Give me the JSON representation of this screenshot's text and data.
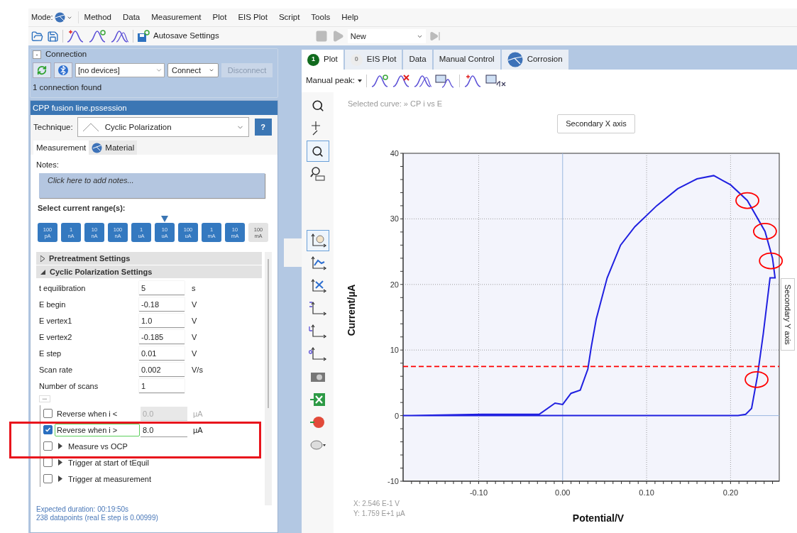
{
  "menu": {
    "mode_label": "Mode:",
    "items": [
      "Method",
      "Data",
      "Measurement",
      "Plot",
      "EIS Plot",
      "Script",
      "Tools",
      "Help"
    ]
  },
  "toolbar": {
    "autosave": "Autosave Settings",
    "run_selector": "New"
  },
  "connection": {
    "title": "Connection",
    "collapse": "-",
    "device": "[no devices]",
    "connect": "Connect",
    "disconnect": "Disconnect",
    "disconnect_disabled": true,
    "status": "1 connection found"
  },
  "session": {
    "title": "CPP fusion line.pssession",
    "technique_label": "Technique:",
    "technique": "Cyclic Polarization",
    "help": "?",
    "tabs": [
      {
        "label": "Measurement",
        "selected": true
      },
      {
        "label": "Material",
        "selected": false
      }
    ],
    "notes_label": "Notes:",
    "notes_placeholder": "Click here to add notes...",
    "ranges_label": "Select current range(s):",
    "ranges": [
      {
        "value": "100",
        "unit": "pA",
        "selected": true,
        "marked": false
      },
      {
        "value": "1",
        "unit": "nA",
        "selected": true,
        "marked": false
      },
      {
        "value": "10",
        "unit": "nA",
        "selected": true,
        "marked": false
      },
      {
        "value": "100",
        "unit": "nA",
        "selected": true,
        "marked": false
      },
      {
        "value": "1",
        "unit": "uA",
        "selected": true,
        "marked": false
      },
      {
        "value": "10",
        "unit": "uA",
        "selected": true,
        "marked": true
      },
      {
        "value": "100",
        "unit": "uA",
        "selected": true,
        "marked": false
      },
      {
        "value": "1",
        "unit": "mA",
        "selected": true,
        "marked": false
      },
      {
        "value": "10",
        "unit": "mA",
        "selected": true,
        "marked": false
      },
      {
        "value": "100",
        "unit": "mA",
        "selected": false,
        "marked": false
      }
    ],
    "sections": [
      {
        "label": "Pretreatment Settings",
        "expanded": false
      },
      {
        "label": "Cyclic Polarization Settings",
        "expanded": true
      }
    ],
    "params": [
      {
        "label": "t equilibration",
        "value": "5",
        "unit": "s"
      },
      {
        "label": "E begin",
        "value": "-0.18",
        "unit": "V"
      },
      {
        "label": "E vertex1",
        "value": "1.0",
        "unit": "V"
      },
      {
        "label": "E vertex2",
        "value": "-0.185",
        "unit": "V"
      },
      {
        "label": "E step",
        "value": "0.01",
        "unit": "V"
      },
      {
        "label": "Scan rate",
        "value": "0.002",
        "unit": "V/s"
      },
      {
        "label": "Number of scans",
        "value": "1"
      }
    ],
    "more": "•••",
    "options": [
      {
        "kind": "limit",
        "label": "Reverse when i <",
        "checked": false,
        "value": "0.0",
        "unit": "µA",
        "disabled": true,
        "focused": false,
        "highlighted": false
      },
      {
        "kind": "limit",
        "label": "Reverse when i >",
        "checked": true,
        "value": "8.0",
        "unit": "µA",
        "disabled": false,
        "focused": true,
        "highlighted": true
      },
      {
        "kind": "expander",
        "label": "Measure vs OCP",
        "checked": false,
        "highlighted": true
      },
      {
        "kind": "expander",
        "label": "Trigger at start of tEquil",
        "checked": false,
        "highlighted": false
      },
      {
        "kind": "expander",
        "label": "Trigger at measurement",
        "checked": false,
        "highlighted": false
      }
    ],
    "duration": "Expected duration: 00:19:50s",
    "datapoints": "238 datapoints (real E step is 0.00999)"
  },
  "plot_tabs": [
    {
      "label": "Plot",
      "badge": "1",
      "badge_on": true,
      "selected": true
    },
    {
      "label": "EIS Plot",
      "badge": "0",
      "badge_on": false,
      "selected": false
    },
    {
      "label": "Data",
      "selected": false
    },
    {
      "label": "Manual Control",
      "selected": false
    },
    {
      "label": "Corrosion",
      "icon": true,
      "selected": false
    }
  ],
  "peak_toolbar": {
    "label": "Manual peak:"
  },
  "plot": {
    "selected_curve": "Selected curve: »",
    "secondary_x": "Secondary X axis",
    "secondary_y": "Secondary Y axis",
    "cursor_x": "X: 2.546 E-1 V",
    "cursor_y": "Y: 1.759 E+1 µA",
    "chart_data": {
      "type": "line",
      "grid": true,
      "xlabel": "Potential/V",
      "ylabel": "Current/µA",
      "xlim": [
        -0.19,
        0.258
      ],
      "ylim": [
        -10,
        40
      ],
      "xticks": [
        {
          "value": -0.1,
          "label": "-0.10"
        },
        {
          "value": 0,
          "label": "0.00"
        },
        {
          "value": 0.1,
          "label": "0.10"
        },
        {
          "value": 0.2,
          "label": "0.20"
        }
      ],
      "yticks": [
        -10,
        0,
        10,
        20,
        30,
        40
      ],
      "x": [
        -0.19,
        -0.1,
        0.0,
        0.1,
        0.2,
        0.209,
        0.218,
        0.225,
        0.232,
        0.239,
        0.247,
        0.253,
        0.25,
        0.241,
        0.22,
        0.2,
        0.18,
        0.16,
        0.137,
        0.112,
        0.086,
        0.069,
        0.053,
        0.04,
        0.034,
        0.03,
        0.021,
        0.01,
        0.0,
        -0.009,
        -0.028,
        -0.096,
        -0.18
      ],
      "series": [
        {
          "name": "CP i vs E",
          "color": "#2020e0",
          "values": [
            0,
            0,
            0,
            0,
            0,
            0,
            0.2,
            1.1,
            6,
            12.5,
            21,
            21,
            24,
            28.1,
            32.8,
            35.2,
            36.6,
            36.1,
            34.6,
            32,
            28.8,
            26,
            21,
            14.7,
            10.4,
            7.1,
            3.9,
            3.4,
            1.7,
            1.9,
            0.2,
            0.2,
            0
          ]
        }
      ],
      "ref_lines": [
        {
          "axis": "y",
          "value": 7.5,
          "color": "#ff0000"
        }
      ]
    }
  }
}
